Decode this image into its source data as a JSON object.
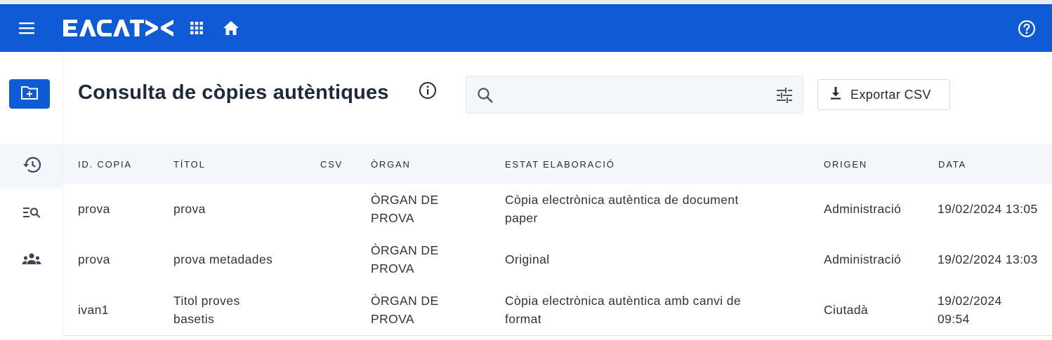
{
  "header": {
    "logo_text": "EACAT",
    "menu_icon": "menu-icon",
    "apps_icon": "apps-grid-icon",
    "home_icon": "home-icon",
    "help_icon": "help-icon",
    "brand_color": "#0f5bd6"
  },
  "sidebar": {
    "items": [
      {
        "name": "add-folder",
        "icon": "folder-add-icon"
      },
      {
        "name": "history",
        "icon": "history-icon",
        "active": true
      },
      {
        "name": "search-list",
        "icon": "list-search-icon"
      },
      {
        "name": "users",
        "icon": "groups-icon"
      }
    ]
  },
  "page": {
    "title": "Consulta de còpies autèntiques"
  },
  "search": {
    "value": "",
    "placeholder": ""
  },
  "toolbar": {
    "export_label": "Exportar CSV"
  },
  "table": {
    "columns": [
      "ID. COPIA",
      "TÍTOL",
      "CSV",
      "ÒRGAN",
      "ESTAT ELABORACIÓ",
      "ORIGEN",
      "DATA"
    ],
    "rows": [
      {
        "id": "prova",
        "titol": [
          "prova"
        ],
        "csv": "",
        "organ": [
          "ÒRGAN DE",
          "PROVA"
        ],
        "estat": [
          "Còpia electrònica autèntica de document",
          "paper"
        ],
        "origen": "Administració",
        "data": [
          "19/02/2024 13:05"
        ]
      },
      {
        "id": "prova",
        "titol": [
          "prova metadades"
        ],
        "csv": "",
        "organ": [
          "ÒRGAN DE",
          "PROVA"
        ],
        "estat": [
          "Original"
        ],
        "origen": "Administració",
        "data": [
          "19/02/2024 13:03"
        ]
      },
      {
        "id": "ivan1",
        "titol": [
          "Titol proves",
          "basetis"
        ],
        "csv": "",
        "organ": [
          "ÒRGAN DE",
          "PROVA"
        ],
        "estat": [
          "Còpia electrònica autèntica amb canvi de",
          "format"
        ],
        "origen": "Ciutadà",
        "data": [
          "19/02/2024",
          "09:54"
        ]
      }
    ]
  }
}
